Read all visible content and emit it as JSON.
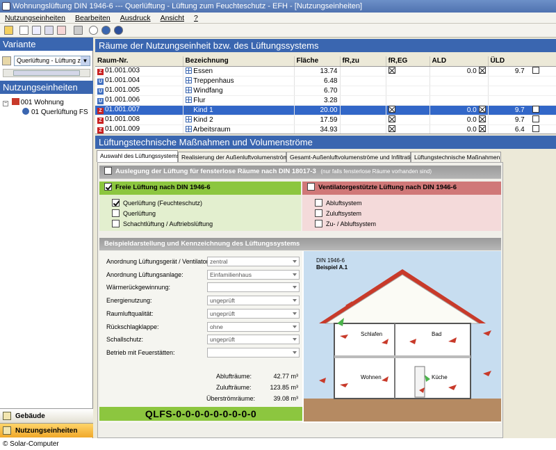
{
  "window": {
    "title": "Wohnungslüftung DIN 1946-6 --- Querlüftung - Lüftung zum Feuchteschutz - EFH - [Nutzungseinheiten]"
  },
  "menu": [
    "Nutzungseinheiten",
    "Bearbeiten",
    "Ausdruck",
    "Ansicht",
    "?"
  ],
  "left": {
    "variante_header": "Variante",
    "variante_select": "Querlüftung - Lüftung zu",
    "nutzung_header": "Nutzungseinheiten",
    "tree": {
      "root": "001 Wohnung",
      "child": "01 Querlüftung FS"
    },
    "nav": [
      {
        "label": "Gebäude"
      },
      {
        "label": "Nutzungseinheiten"
      }
    ]
  },
  "rooms": {
    "header": "Räume der Nutzungseinheit bzw. des Lüftungssystems",
    "columns": [
      "Raum-Nr.",
      "Bezeichnung",
      "Fläche",
      "fR,zu",
      "fR,EG",
      "ALD",
      "ÜLD"
    ],
    "rows": [
      {
        "type": "Z",
        "nr": "01.001.003",
        "name": "Essen",
        "area": "13.74",
        "fEG": "x",
        "ald": "0.0",
        "ald_cb": "x",
        "uld": "9.7",
        "uld_cb": ""
      },
      {
        "type": "U",
        "nr": "01.001.004",
        "name": "Treppenhaus",
        "area": "6.48",
        "fEG": "",
        "ald": "",
        "ald_cb": "",
        "uld": "",
        "uld_cb": ""
      },
      {
        "type": "U",
        "nr": "01.001.005",
        "name": "Windfang",
        "area": "6.70",
        "fEG": "",
        "ald": "",
        "ald_cb": "",
        "uld": "",
        "uld_cb": ""
      },
      {
        "type": "U",
        "nr": "01.001.006",
        "name": "Flur",
        "area": "3.28",
        "fEG": "",
        "ald": "",
        "ald_cb": "",
        "uld": "",
        "uld_cb": ""
      },
      {
        "type": "Z",
        "nr": "01.001.007",
        "name": "Kind 1",
        "area": "20.00",
        "fEG": "x",
        "ald": "0.0",
        "ald_cb": "x",
        "uld": "9.7",
        "uld_cb": "",
        "selected": true
      },
      {
        "type": "Z",
        "nr": "01.001.008",
        "name": "Kind 2",
        "area": "17.59",
        "fEG": "x",
        "ald": "0.0",
        "ald_cb": "x",
        "uld": "9.7",
        "uld_cb": ""
      },
      {
        "type": "Z",
        "nr": "01.001.009",
        "name": "Arbeitsraum",
        "area": "34.93",
        "fEG": "x",
        "ald": "0.0",
        "ald_cb": "x",
        "uld": "6.4",
        "uld_cb": ""
      }
    ]
  },
  "measures": {
    "header": "Lüftungstechnische Maßnahmen und Volumenströme",
    "tabs": [
      "Auswahl des Lüftungssystems",
      "Realisierung der Außenluftvolumenströme",
      "Gesamt-Außenluftvolumenströme und Infiltration",
      "Lüftungstechnische Maßnahmen"
    ],
    "auslegung": "Auslegung der Lüftung für fensterlose Räume nach DIN 18017-3",
    "auslegung_hint": "(nur falls fensterlose Räume vorhanden sind)",
    "freie": {
      "title": "Freie Lüftung nach DIN 1946-6",
      "options": [
        "Querlüftung (Feuchteschutz)",
        "Querlüftung",
        "Schachtlüftung / Auftriebslüftung"
      ]
    },
    "ventilator": {
      "title": "Ventilatorgestützte Lüftung nach DIN 1946-6",
      "options": [
        "Abluftsystem",
        "Zuluftsystem",
        "Zu- / Abluftsystem"
      ]
    },
    "beispiel_header": "Beispieldarstellung und Kennzeichnung des Lüftungssystems",
    "form": [
      {
        "label": "Anordnung Lüftungsgerät / Ventilator:",
        "value": "zentral"
      },
      {
        "label": "Anordnung Lüftungsanlage:",
        "value": "Einfamilienhaus"
      },
      {
        "label": "Wärmerückgewinnung:",
        "value": ""
      },
      {
        "label": "Energienutzung:",
        "value": "ungeprüft"
      },
      {
        "label": "Raumluftqualität:",
        "value": "ungeprüft"
      },
      {
        "label": "Rückschlagklappe:",
        "value": "ohne"
      },
      {
        "label": "Schallschutz:",
        "value": "ungeprüft"
      },
      {
        "label": "Betrieb mit Feuerstätten:",
        "value": ""
      }
    ],
    "summary": [
      {
        "label": "Ablufträume:",
        "value": "42.77 m³"
      },
      {
        "label": "Zulufträume:",
        "value": "123.85 m³"
      },
      {
        "label": "Überströmräume:",
        "value": "39.08 m³"
      }
    ],
    "code": "QLFS-0-0-0-0-0-0-0-0-0",
    "diagram": {
      "title1": "DIN 1946-6",
      "title2": "Beispiel A.1",
      "rooms": [
        "Schlafen",
        "Bad",
        "Wohnen",
        "Küche"
      ]
    }
  },
  "footer": "© Solar-Computer",
  "colors": {
    "accent": "#3a66b0",
    "green": "#8cc63f",
    "red": "#d07878",
    "sky": "#c7ddf0"
  }
}
